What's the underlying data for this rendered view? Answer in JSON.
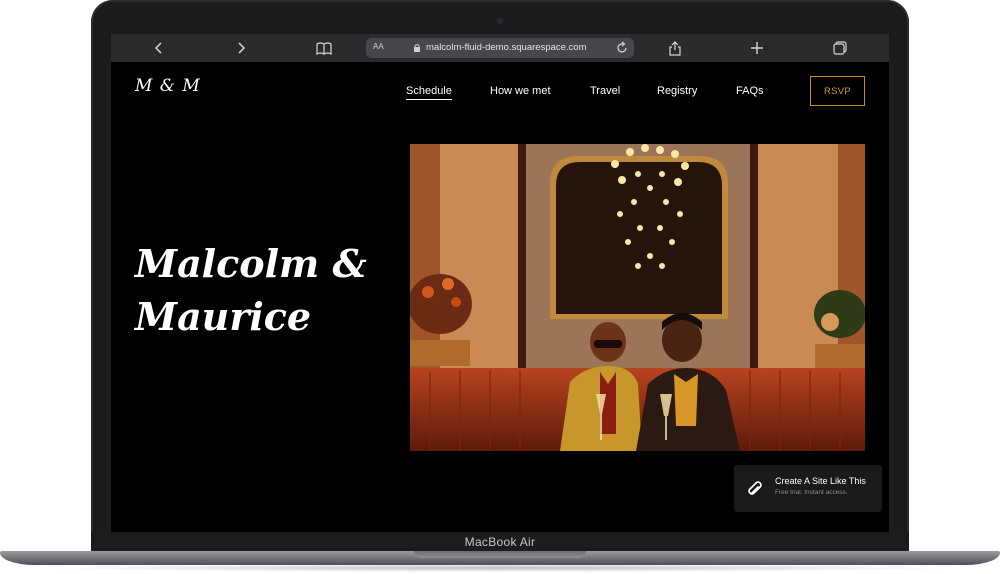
{
  "device": {
    "label": "MacBook Air"
  },
  "browser": {
    "text_size_label": "AA",
    "url": "malcolm-fluid-demo.squarespace.com",
    "icons": [
      "back-icon",
      "forward-icon",
      "reading-list-icon",
      "lock-icon",
      "reload-icon",
      "share-icon",
      "new-tab-icon",
      "tabs-icon"
    ]
  },
  "site": {
    "logo": "M & M",
    "nav": [
      {
        "label": "Schedule",
        "active": true
      },
      {
        "label": "How we met"
      },
      {
        "label": "Travel"
      },
      {
        "label": "Registry"
      },
      {
        "label": "FAQs"
      }
    ],
    "rsvp_label": "RSVP",
    "hero": {
      "line1": "Malcolm &",
      "line2": "Maurice"
    },
    "accent_color": "#c08a24",
    "background_color": "#000000"
  },
  "promo": {
    "title": "Create A Site Like This",
    "subtitle": "Free trial. Instant access.",
    "icon": "squarespace-logo-icon"
  }
}
